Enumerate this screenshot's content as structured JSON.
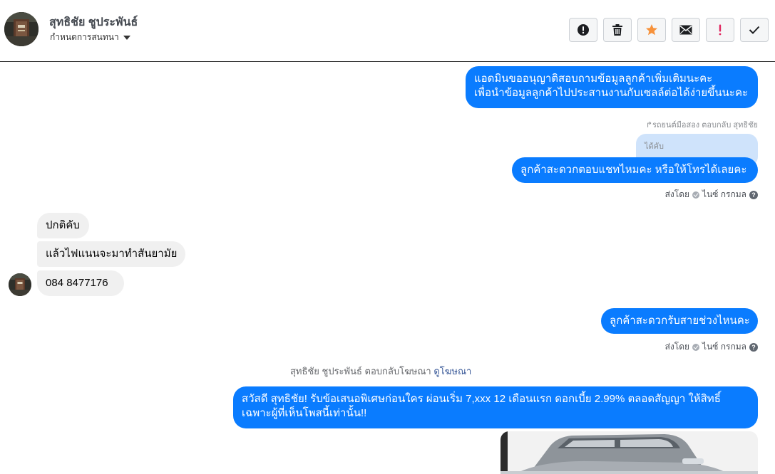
{
  "header": {
    "contact_name": "สุทธิชัย ชูประพันธ์",
    "settings_label": "กำหนดการสนทนา",
    "toolbar": [
      {
        "name": "report-spam-button",
        "icon": "alert-circle-icon",
        "color": "#1c1e21"
      },
      {
        "name": "delete-button",
        "icon": "trash-icon",
        "color": "#1c1e21"
      },
      {
        "name": "star-button",
        "icon": "star-icon",
        "color": "#f7923b"
      },
      {
        "name": "mark-unread-button",
        "icon": "envelope-icon",
        "color": "#1c1e21"
      },
      {
        "name": "mark-important-button",
        "icon": "exclamation-icon",
        "color": "#e0245e"
      },
      {
        "name": "mark-done-button",
        "icon": "check-icon",
        "color": "#1c1e21"
      }
    ]
  },
  "messages": {
    "m1_line1": "แอดมินขออนุญาติสอบถามข้อมูลลูกค้าเพิ่มเติมนะคะ",
    "m1_line2": "เพื่อนำข้อมูลลูกค้าไปประสานงานกับเซลล์ต่อได้ง่ายขึ้นนะคะ",
    "reply_note": "รถยนต์มือสอง ตอบกลับ สุทธิชัย",
    "quoted_text": "ได้คับ",
    "m2": "ลูกค้าสะดวกตอบแชทไหมคะ หรือให้โทรได้เลยคะ",
    "m2_sent_by": "ส่งโดย",
    "m2_sender": "ไนซ์ กรกมล",
    "in1": "ปกติคับ",
    "in2": "แล้วไฟแนนจะมาทำสันยามัย",
    "in3": "084  8477176",
    "m3": "ลูกค้าสะดวกรับสายช่วงไหนคะ",
    "m3_sent_by": "ส่งโดย",
    "m3_sender": "ไนซ์ กรกมล",
    "ad_reply_text": "สุทธิชัย ชูประพันธ์ ตอบกลับโฆษณา",
    "ad_link": "ดูโฆษณา",
    "m4_line1": "สวัสดี สุทธิชัย! รับข้อเสนอพิเศษก่อนใคร ผ่อนเริ่ม 7,xxx 12 เดือนแรก ดอกเบี้ย 2.99% ตลอดสัญญา ให้สิทธิ์",
    "m4_line2": "เฉพาะผู้ที่เห็นโพสนี้เท่านั้น!!"
  },
  "colors": {
    "outgoing_bubble": "#0a7cff",
    "incoming_bubble": "#f0f0f0",
    "quoted_bubble": "#cfe3fb",
    "link": "#385898"
  }
}
